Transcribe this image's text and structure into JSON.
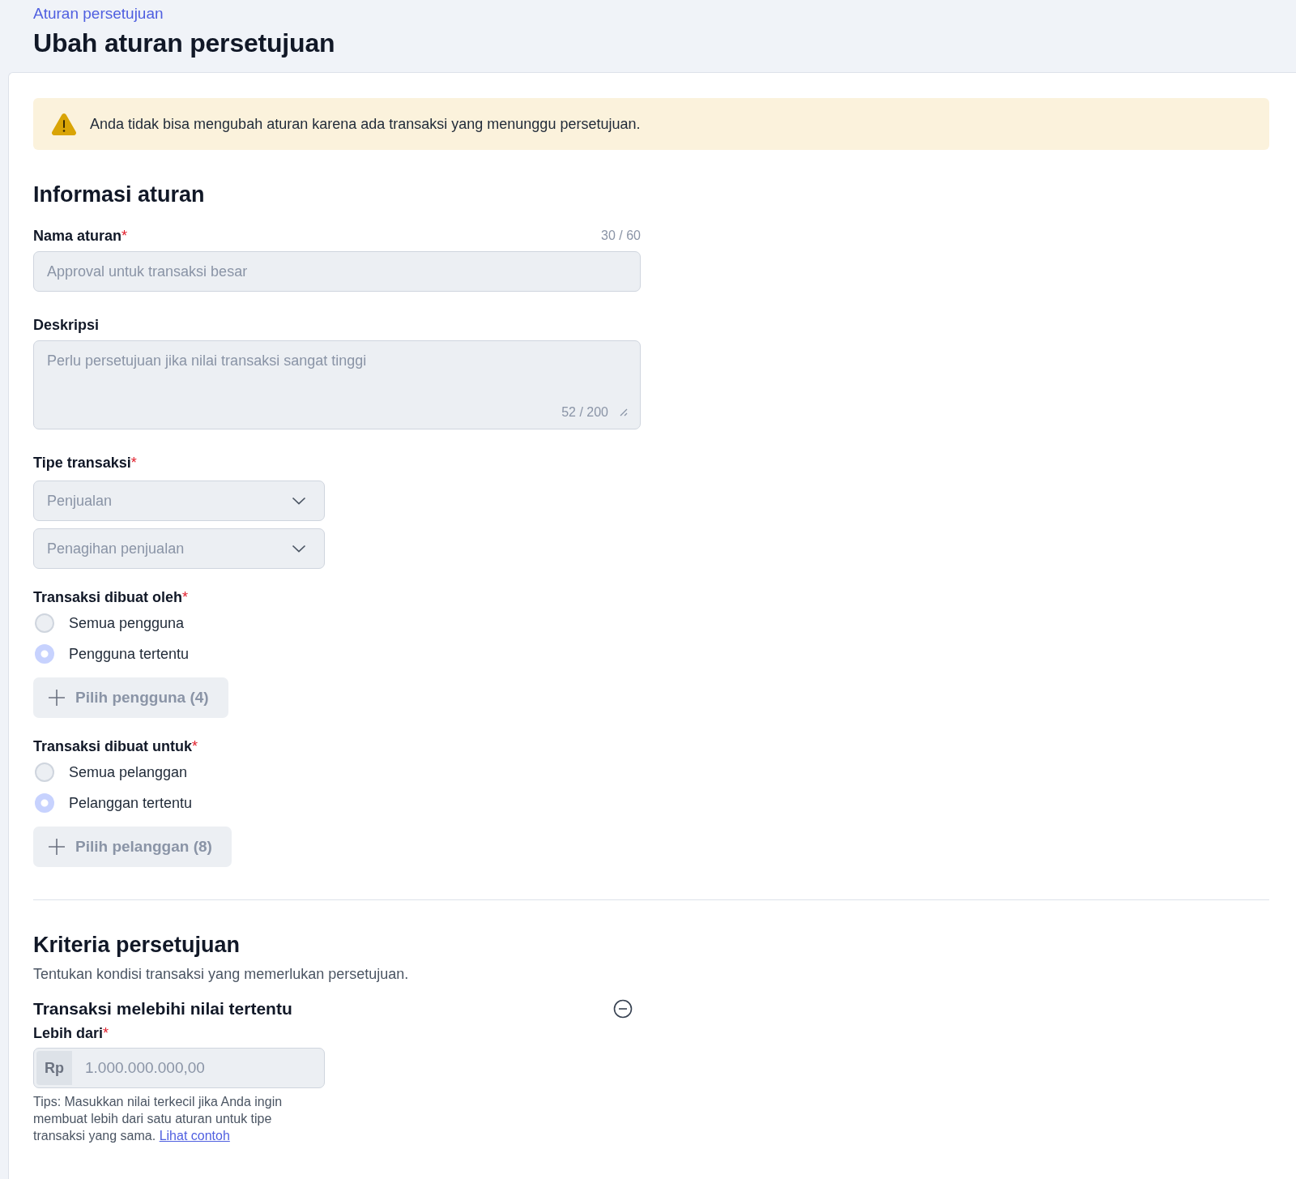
{
  "breadcrumb": "Aturan persetujuan",
  "title": "Ubah aturan persetujuan",
  "alert": {
    "kind": "warning",
    "text": "Anda tidak bisa mengubah aturan karena ada transaksi yang menunggu persetujuan."
  },
  "rule_info": {
    "heading": "Informasi aturan",
    "name_field": {
      "label": "Nama aturan",
      "required_mark": "*",
      "counter": "30 / 60",
      "value": "Approval untuk transaksi besar",
      "disabled": true
    },
    "description_field": {
      "label": "Deskripsi",
      "value": "Perlu persetujuan jika nilai transaksi sangat tinggi",
      "counter": "52 / 200",
      "disabled": true
    },
    "transaction_type": {
      "label": "Tipe transaksi",
      "required_mark": "*",
      "selects": [
        {
          "value": "Penjualan",
          "disabled": true
        },
        {
          "value": "Penagihan penjualan",
          "disabled": true
        }
      ]
    },
    "created_by": {
      "label": "Transaksi dibuat oleh",
      "required_mark": "*",
      "options": [
        {
          "label": "Semua pengguna",
          "selected": false,
          "disabled": true
        },
        {
          "label": "Pengguna tertentu",
          "selected": true,
          "disabled": true
        }
      ],
      "button": {
        "label": "Pilih pengguna (4)",
        "disabled": true
      }
    },
    "created_for": {
      "label": "Transaksi dibuat untuk",
      "required_mark": "*",
      "options": [
        {
          "label": "Semua pelanggan",
          "selected": false,
          "disabled": true
        },
        {
          "label": "Pelanggan tertentu",
          "selected": true,
          "disabled": true
        }
      ],
      "button": {
        "label": "Pilih pelanggan (8)",
        "disabled": true
      }
    }
  },
  "criteria": {
    "heading": "Kriteria persetujuan",
    "description": "Tentukan kondisi transaksi yang memerlukan persetujuan.",
    "items": [
      {
        "title": "Transaksi melebihi nilai tertentu",
        "field_label": "Lebih dari",
        "required_mark": "*",
        "prefix": "Rp",
        "value": "1.000.000.000,00",
        "disabled": true,
        "tip": "Tips: Masukkan nilai terkecil jika Anda ingin membuat lebih dari satu aturan untuk tipe transaksi yang sama.",
        "tip_link": "Lihat contoh"
      }
    ]
  }
}
